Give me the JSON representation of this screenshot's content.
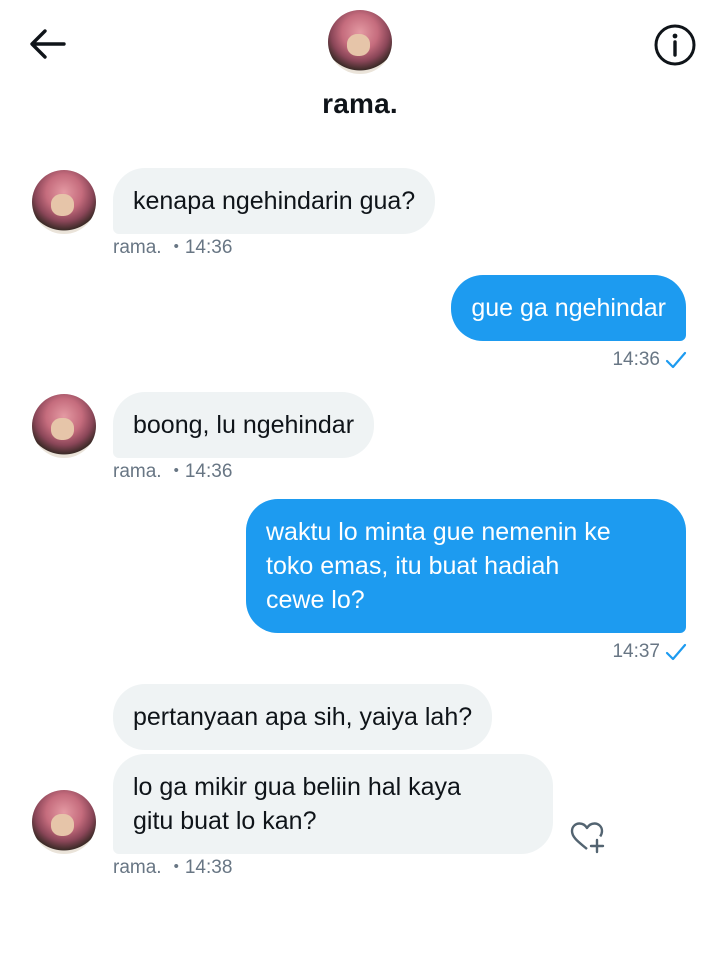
{
  "header": {
    "contact_name": "rama.",
    "back_icon": "arrow-left-icon",
    "info_icon": "info-icon"
  },
  "messages": [
    {
      "direction": "incoming",
      "text": "kenapa ngehindarin gua?",
      "sender": "rama.",
      "time": "14:36"
    },
    {
      "direction": "outgoing",
      "text": "gue ga ngehindar",
      "time": "14:36",
      "status_icon": "checkmark-icon"
    },
    {
      "direction": "incoming",
      "text": "boong, lu ngehindar",
      "sender": "rama.",
      "time": "14:36"
    },
    {
      "direction": "outgoing",
      "text": "waktu lo minta gue nemenin ke\ntoko emas, itu buat hadiah\ncewe lo?",
      "time": "14:37",
      "status_icon": "checkmark-icon"
    },
    {
      "direction": "incoming",
      "text": "pertanyaan apa sih, yaiya lah?"
    },
    {
      "direction": "incoming",
      "text": "lo ga mikir gua beliin hal kaya\ngitu buat lo kan?",
      "sender": "rama.",
      "time": "14:38",
      "reaction_icon": "heart-plus-icon"
    }
  ],
  "meta": {
    "dot": "•"
  },
  "colors": {
    "outgoing_bubble": "#1d9bf0",
    "incoming_bubble": "#eff3f4",
    "meta_text": "#687684",
    "check": "#1d9bf0"
  }
}
